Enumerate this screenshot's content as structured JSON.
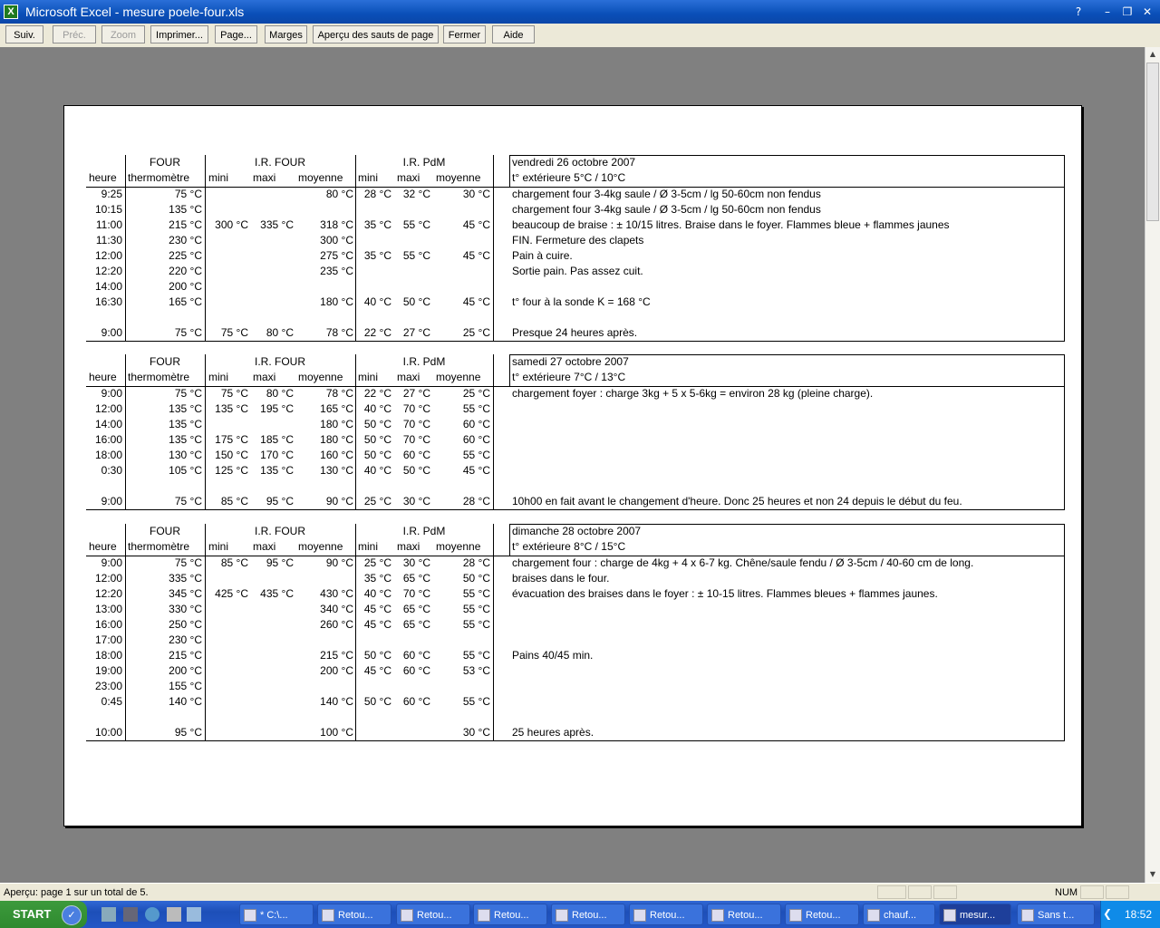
{
  "window": {
    "title": "Microsoft Excel - mesure poele-four.xls",
    "app_icon_glyph": "X",
    "help_icon": "?",
    "minimize": "–",
    "restore": "❐",
    "close": "✕"
  },
  "toolbar": {
    "next": "Suiv.",
    "prev": "Préc.",
    "zoom": "Zoom",
    "print": "Imprimer...",
    "page": "Page...",
    "margins": "Marges",
    "page_breaks": "Aperçu des sauts de page",
    "close": "Fermer",
    "help": "Aide"
  },
  "scroll": {
    "up": "▲",
    "down": "▼"
  },
  "sheet": {
    "headers": {
      "four": "FOUR",
      "ir_four": "I.R. FOUR",
      "ir_pdm": "I.R. PdM",
      "heure": "heure",
      "thermometre": "thermomètre",
      "mini": "mini",
      "maxi": "maxi",
      "moyenne": "moyenne"
    },
    "blocks": [
      {
        "date": "vendredi 26 octobre 2007",
        "ext": "t° extérieure 5°C / 10°C",
        "rows": [
          [
            "9:25",
            "75 °C",
            "",
            "",
            "80 °C",
            "28 °C",
            "32 °C",
            "30 °C",
            "chargement four 3-4kg saule / Ø 3-5cm / lg 50-60cm non fendus"
          ],
          [
            "10:15",
            "135 °C",
            "",
            "",
            "",
            "",
            "",
            "",
            "chargement four 3-4kg saule / Ø 3-5cm / lg 50-60cm non fendus"
          ],
          [
            "11:00",
            "215 °C",
            "300 °C",
            "335 °C",
            "318 °C",
            "35 °C",
            "55 °C",
            "45 °C",
            "beaucoup de braise : ± 10/15 litres. Braise dans le foyer. Flammes bleue + flammes jaunes"
          ],
          [
            "11:30",
            "230 °C",
            "",
            "",
            "300 °C",
            "",
            "",
            "",
            "FIN. Fermeture des clapets"
          ],
          [
            "12:00",
            "225 °C",
            "",
            "",
            "275 °C",
            "35 °C",
            "55 °C",
            "45 °C",
            "Pain à cuire."
          ],
          [
            "12:20",
            "220 °C",
            "",
            "",
            "235 °C",
            "",
            "",
            "",
            "Sortie pain. Pas assez cuit."
          ],
          [
            "14:00",
            "200 °C",
            "",
            "",
            "",
            "",
            "",
            "",
            ""
          ],
          [
            "16:30",
            "165 °C",
            "",
            "",
            "180 °C",
            "40 °C",
            "50 °C",
            "45 °C",
            "t° four à la sonde K = 168 °C"
          ]
        ],
        "final": [
          "9:00",
          "75 °C",
          "75 °C",
          "80 °C",
          "78 °C",
          "22 °C",
          "27 °C",
          "25 °C",
          "Presque 24 heures après."
        ]
      },
      {
        "date": "samedi 27 octobre 2007",
        "ext": "t° extérieure 7°C / 13°C",
        "rows": [
          [
            "9:00",
            "75 °C",
            "75 °C",
            "80 °C",
            "78 °C",
            "22 °C",
            "27 °C",
            "25 °C",
            "chargement foyer : charge 3kg +  5 x 5-6kg = environ 28 kg (pleine charge)."
          ],
          [
            "12:00",
            "135 °C",
            "135 °C",
            "195 °C",
            "165 °C",
            "40 °C",
            "70 °C",
            "55 °C",
            ""
          ],
          [
            "14:00",
            "135 °C",
            "",
            "",
            "180 °C",
            "50 °C",
            "70 °C",
            "60 °C",
            ""
          ],
          [
            "16:00",
            "135 °C",
            "175 °C",
            "185 °C",
            "180 °C",
            "50 °C",
            "70 °C",
            "60 °C",
            ""
          ],
          [
            "18:00",
            "130 °C",
            "150 °C",
            "170 °C",
            "160 °C",
            "50 °C",
            "60 °C",
            "55 °C",
            ""
          ],
          [
            "0:30",
            "105 °C",
            "125 °C",
            "135 °C",
            "130 °C",
            "40 °C",
            "50 °C",
            "45 °C",
            ""
          ]
        ],
        "final": [
          "9:00",
          "75 °C",
          "85 °C",
          "95 °C",
          "90 °C",
          "25 °C",
          "30 °C",
          "28 °C",
          "10h00 en fait avant le changement d'heure. Donc 25 heures et non 24 depuis le début du feu."
        ]
      },
      {
        "date": "dimanche 28 octobre 2007",
        "ext": "t° extérieure 8°C / 15°C",
        "rows": [
          [
            "9:00",
            "75 °C",
            "85 °C",
            "95 °C",
            "90 °C",
            "25 °C",
            "30 °C",
            "28 °C",
            "chargement four : charge de 4kg + 4 x 6-7 kg. Chêne/saule fendu / Ø 3-5cm / 40-60 cm de long."
          ],
          [
            "12:00",
            "335 °C",
            "",
            "",
            "",
            "35 °C",
            "65 °C",
            "50 °C",
            "braises dans le four."
          ],
          [
            "12:20",
            "345 °C",
            "425 °C",
            "435 °C",
            "430 °C",
            "40 °C",
            "70 °C",
            "55 °C",
            "évacuation des braises dans le foyer : ± 10-15 litres. Flammes bleues + flammes jaunes."
          ],
          [
            "13:00",
            "330 °C",
            "",
            "",
            "340 °C",
            "45 °C",
            "65 °C",
            "55 °C",
            ""
          ],
          [
            "16:00",
            "250 °C",
            "",
            "",
            "260 °C",
            "45 °C",
            "65 °C",
            "55 °C",
            ""
          ],
          [
            "17:00",
            "230 °C",
            "",
            "",
            "",
            "",
            "",
            "",
            ""
          ],
          [
            "18:00",
            "215 °C",
            "",
            "",
            "215 °C",
            "50 °C",
            "60 °C",
            "55 °C",
            "Pains 40/45 min."
          ],
          [
            "19:00",
            "200 °C",
            "",
            "",
            "200 °C",
            "45 °C",
            "60 °C",
            "53 °C",
            ""
          ],
          [
            "23:00",
            "155 °C",
            "",
            "",
            "",
            "",
            "",
            "",
            ""
          ],
          [
            "0:45",
            "140 °C",
            "",
            "",
            "140 °C",
            "50 °C",
            "60 °C",
            "55 °C",
            ""
          ]
        ],
        "final": [
          "10:00",
          "95 °C",
          "",
          "",
          "100 °C",
          "",
          "",
          "30 °C",
          "25 heures après."
        ]
      }
    ]
  },
  "status": {
    "message": "Aperçu: page 1 sur un total de 5.",
    "num": "NUM"
  },
  "taskbar": {
    "start": "START",
    "tasks": [
      "* C:\\...",
      "Retou...",
      "Retou...",
      "Retou...",
      "Retou...",
      "Retou...",
      "Retou...",
      "Retou...",
      "chauf...",
      "mesur...",
      "Sans t..."
    ],
    "clock": "18:52"
  }
}
